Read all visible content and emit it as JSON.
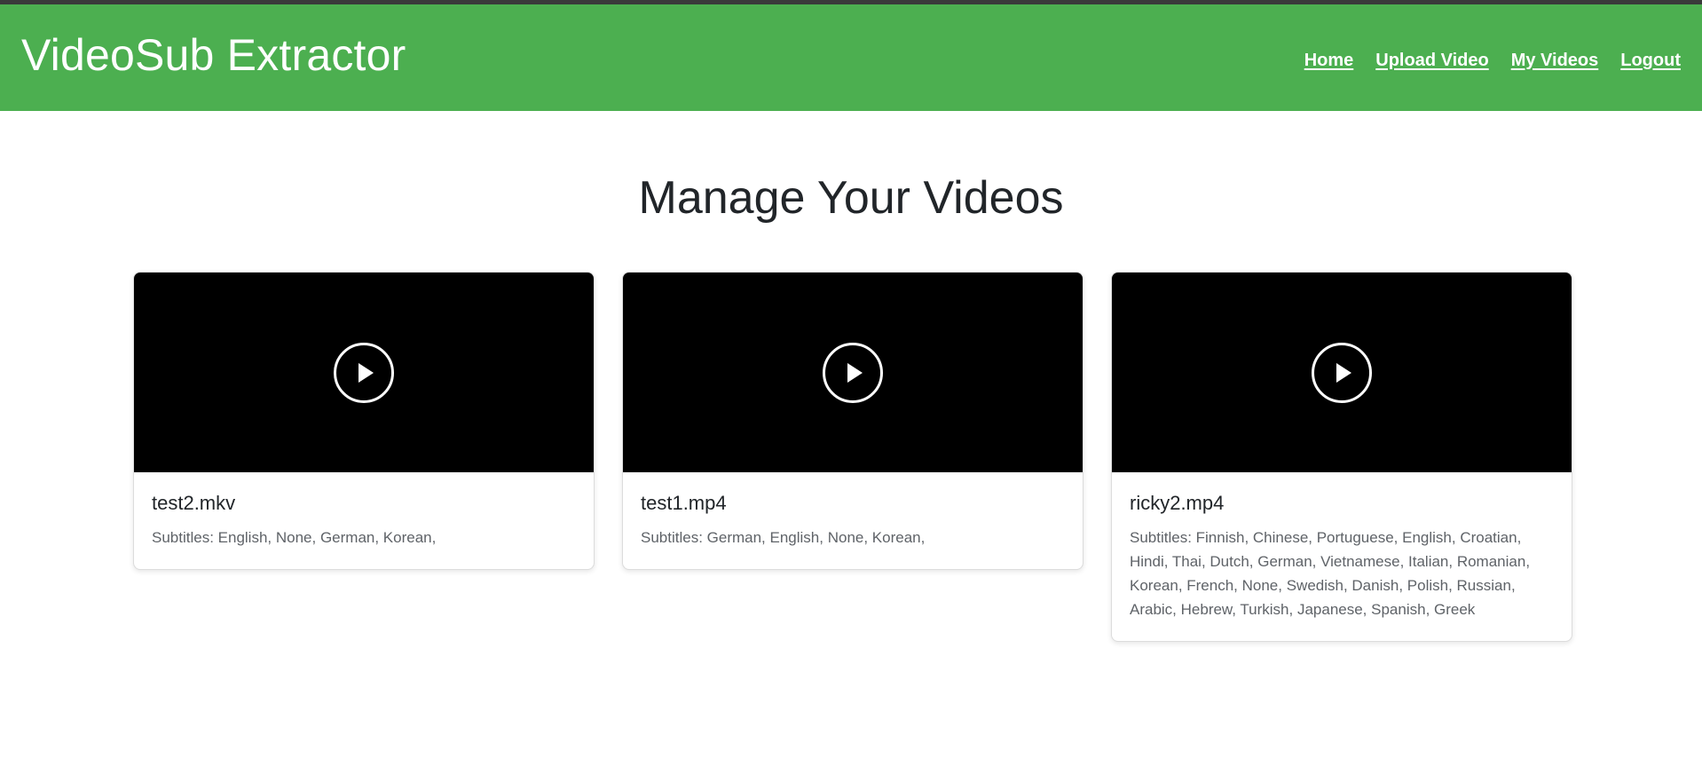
{
  "header": {
    "brand": "VideoSub Extractor",
    "nav": [
      "Home",
      "Upload Video",
      "My Videos",
      "Logout"
    ],
    "bg_color": "#4caf50"
  },
  "main": {
    "title": "Manage Your Videos"
  },
  "videos": [
    {
      "name": "test2.mkv",
      "subtitles": "Subtitles: English, None, German, Korean,",
      "icon": "play-icon"
    },
    {
      "name": "test1.mp4",
      "subtitles": "Subtitles: German, English, None, Korean,",
      "icon": "play-icon"
    },
    {
      "name": "ricky2.mp4",
      "subtitles": "Subtitles: Finnish, Chinese, Portuguese, English, Croatian, Hindi, Thai, Dutch, German, Vietnamese, Italian, Romanian, Korean, French, None, Swedish, Danish, Polish, Russian, Arabic, Hebrew, Turkish, Japanese, Spanish, Greek",
      "icon": "play-icon"
    }
  ]
}
